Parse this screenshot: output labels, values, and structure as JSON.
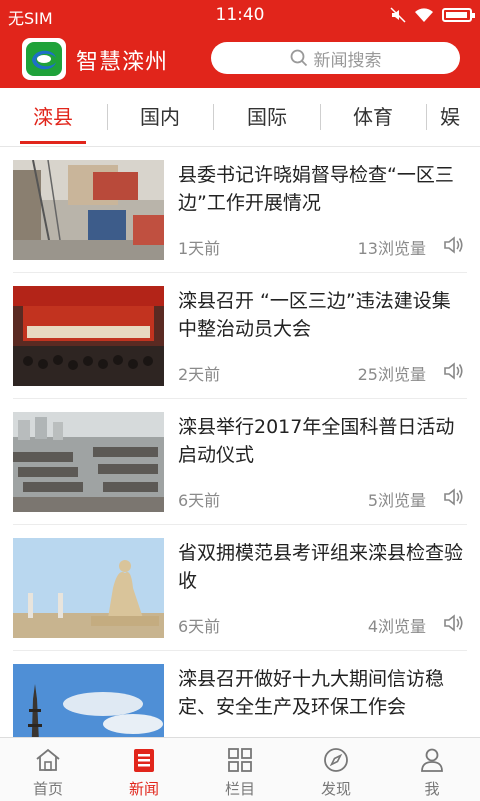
{
  "status": {
    "carrier": "无SIM",
    "time": "11:40"
  },
  "app": {
    "title": "智慧滦州"
  },
  "search": {
    "placeholder": "新闻搜索"
  },
  "tabs": [
    {
      "label": "滦县",
      "active": true
    },
    {
      "label": "国内"
    },
    {
      "label": "国际"
    },
    {
      "label": "体育"
    },
    {
      "label": "娱"
    }
  ],
  "news": [
    {
      "title": "县委书记许晓娟督导检查“一区三边”工作开展情况",
      "time": "1天前",
      "views": "13浏览量"
    },
    {
      "title": "滦县召开 “一区三边”违法建设集中整治动员大会",
      "time": "2天前",
      "views": "25浏览量"
    },
    {
      "title": "滦县举行2017年全国科普日活动启动仪式",
      "time": "6天前",
      "views": "5浏览量"
    },
    {
      "title": "省双拥模范县考评组来滦县检查验收",
      "time": "6天前",
      "views": "4浏览量"
    },
    {
      "title": "滦县召开做好十九大期间信访稳定、安全生产及环保工作会",
      "time": "",
      "views": ""
    }
  ],
  "bottom_nav": [
    {
      "label": "首页",
      "icon": "home-icon"
    },
    {
      "label": "新闻",
      "icon": "news-icon",
      "active": true
    },
    {
      "label": "栏目",
      "icon": "grid-icon"
    },
    {
      "label": "发现",
      "icon": "compass-icon"
    },
    {
      "label": "我",
      "icon": "user-icon"
    }
  ],
  "colors": {
    "accent": "#e1251b"
  }
}
